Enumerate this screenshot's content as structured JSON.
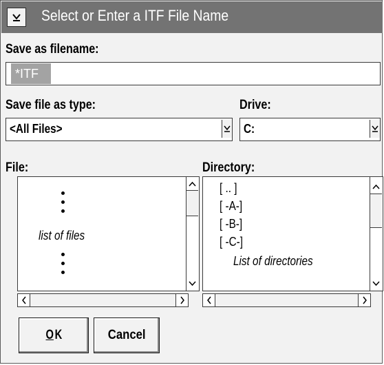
{
  "window": {
    "title": "Select or Enter a ITF File Name"
  },
  "save_as": {
    "label": "Save as filename:",
    "value": "*ITF"
  },
  "file_type": {
    "label": "Save file as type:",
    "value": "<All Files>"
  },
  "drive": {
    "label": "Drive:",
    "value": "C:"
  },
  "file_list": {
    "label": "File:",
    "placeholder": "list of files"
  },
  "directory_list": {
    "label": "Directory:",
    "items": [
      "[ .. ]",
      "[ -A-]",
      "[ -B-]",
      "[ -C-]"
    ],
    "placeholder": "List of directories"
  },
  "buttons": {
    "ok_mnemonic": "O",
    "ok_rest": "K",
    "cancel": "Cancel"
  },
  "icons": {
    "system_menu": "system-menu-icon",
    "dropdown": "chevron-down-icon",
    "scroll_up": "arrow-up-icon",
    "scroll_down": "arrow-down-icon",
    "scroll_left": "arrow-left-icon",
    "scroll_right": "arrow-right-icon"
  }
}
